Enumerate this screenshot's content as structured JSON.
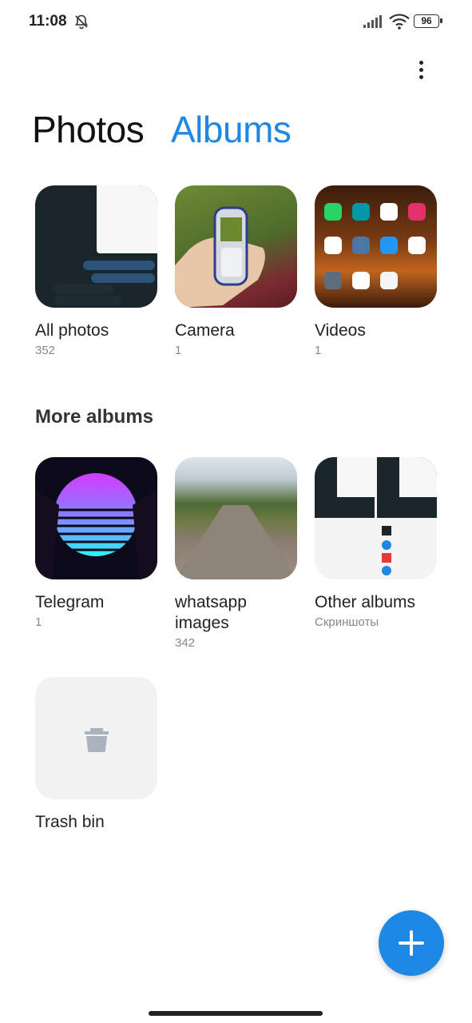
{
  "status_bar": {
    "time": "11:08",
    "battery": "96"
  },
  "tabs": {
    "photos": "Photos",
    "albums": "Albums"
  },
  "albums": [
    {
      "title": "All photos",
      "count": "352"
    },
    {
      "title": "Camera",
      "count": "1"
    },
    {
      "title": "Videos",
      "count": "1"
    }
  ],
  "more_albums": {
    "heading": "More albums",
    "items": [
      {
        "title": "Telegram",
        "count": "1"
      },
      {
        "title": "whatsapp images",
        "count": "342"
      },
      {
        "title": "Other albums",
        "count": "Скриншоты"
      },
      {
        "title": "Trash bin"
      }
    ]
  },
  "colors": {
    "accent": "#1e88e5",
    "text": "#222222",
    "secondary": "#888888"
  },
  "icons": [
    "bell-off-icon",
    "signal-icon",
    "wifi-icon",
    "battery-icon",
    "more-vert-icon",
    "trash-icon",
    "plus-icon"
  ]
}
